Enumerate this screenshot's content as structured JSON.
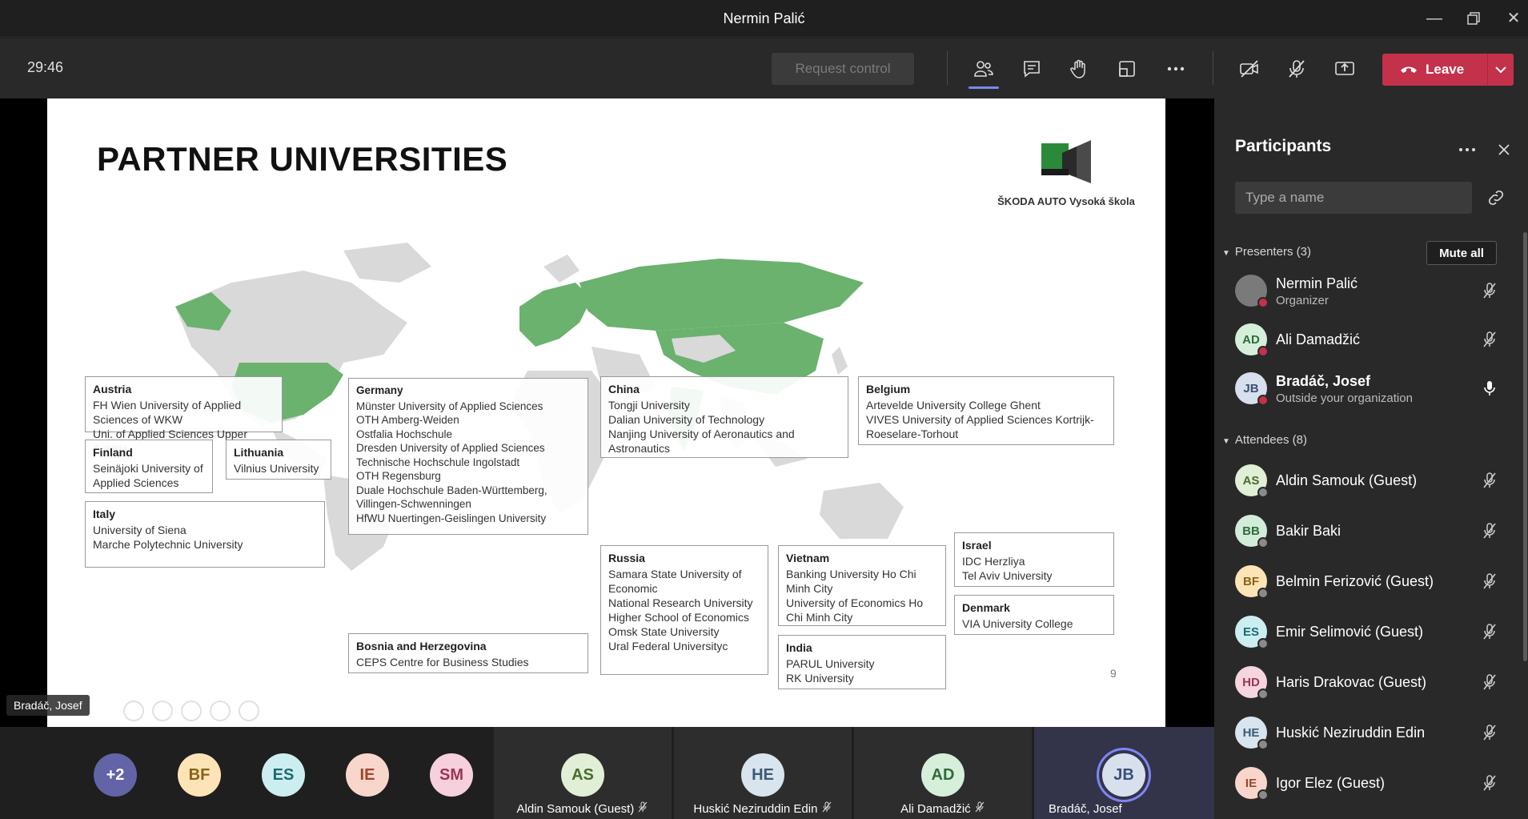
{
  "window": {
    "title": "Nermin Palić"
  },
  "toolbar": {
    "timer": "29:46",
    "request_control": "Request control",
    "leave": "Leave"
  },
  "slide": {
    "title": "PARTNER UNIVERSITIES",
    "logo_text": "ŠKODA AUTO Vysoká škola",
    "page_number": "9",
    "countries": [
      {
        "name": "Austria",
        "unis": [
          "FH Wien University of Applied Sciences of WKW",
          "Uni. of Applied Sciences Upper Austria"
        ]
      },
      {
        "name": "Finland",
        "unis": [
          "Seinäjoki University of Applied Sciences"
        ]
      },
      {
        "name": "Lithuania",
        "unis": [
          "Vilnius University"
        ]
      },
      {
        "name": "Italy",
        "unis": [
          "University of Siena",
          "Marche Polytechnic University"
        ]
      },
      {
        "name": "Germany",
        "unis": [
          "Münster University of Applied Sciences",
          "OTH Amberg-Weiden",
          "Ostfalia Hochschule",
          "Dresden University of Applied Sciences",
          "Technische Hochschule Ingolstadt",
          "OTH Regensburg",
          "Duale Hochschule Baden-Württemberg, Villingen-Schwenningen",
          "HfWU Nuertingen-Geislingen University"
        ]
      },
      {
        "name": "Bosnia and Herzegovina",
        "unis": [
          "CEPS Centre for Business Studies"
        ]
      },
      {
        "name": "China",
        "unis": [
          "Tongji University",
          "Dalian University of Technology",
          "Nanjing University of Aeronautics and Astronautics"
        ]
      },
      {
        "name": "Russia",
        "unis": [
          "Samara State University of Economic",
          "National Research University Higher School of Economics",
          "Omsk State University",
          "Ural Federal Universityc"
        ]
      },
      {
        "name": "Vietnam",
        "unis": [
          "Banking University Ho Chi Minh City",
          "University of Economics Ho Chi Minh City"
        ]
      },
      {
        "name": "India",
        "unis": [
          "PARUL University",
          "RK University"
        ]
      },
      {
        "name": "Belgium",
        "unis": [
          "Artevelde University College Ghent",
          "VIVES University of Applied Sciences Kortrijk-Roeselare-Torhout"
        ]
      },
      {
        "name": "Israel",
        "unis": [
          "IDC Herzliya",
          "Tel Aviv University"
        ]
      },
      {
        "name": "Denmark",
        "unis": [
          "VIA University College"
        ]
      }
    ]
  },
  "presenter_label": "Bradáč, Josef",
  "gallery": {
    "overflow": "+2",
    "small": [
      {
        "initials": "BF",
        "bg": "#fce4b6",
        "fg": "#8a6116"
      },
      {
        "initials": "ES",
        "bg": "#cdeef0",
        "fg": "#1d6a70"
      },
      {
        "initials": "IE",
        "bg": "#f8d6cc",
        "fg": "#a0452b"
      },
      {
        "initials": "SM",
        "bg": "#f6d0dc",
        "fg": "#9b3556"
      }
    ],
    "tiles": [
      {
        "initials": "AS",
        "name": "Aldin Samouk (Guest)",
        "bg": "#e0efd6",
        "fg": "#4a6b2e"
      },
      {
        "initials": "HE",
        "name": "Huskić Neziruddin Edin",
        "bg": "#d8e4ee",
        "fg": "#3c5a74"
      },
      {
        "initials": "AD",
        "name": "Ali Damadžić",
        "bg": "#d6efdb",
        "fg": "#2f6b3c"
      },
      {
        "initials": "JB",
        "name": "Bradáč, Josef",
        "bg": "#d8e0ee",
        "fg": "#3c4f74"
      }
    ]
  },
  "panel": {
    "title": "Participants",
    "search_placeholder": "Type a name",
    "presenters_header": "Presenters (3)",
    "mute_all": "Mute all",
    "attendees_header": "Attendees (8)",
    "presenters": [
      {
        "initials": "",
        "name": "Nermin Palić",
        "sub": "Organizer",
        "bg": "#7a7a7a",
        "fg": "#fff",
        "status": "#c4314b",
        "mic": "muted"
      },
      {
        "initials": "AD",
        "name": "Ali Damadžić",
        "sub": "",
        "bg": "#d6efdb",
        "fg": "#2f6b3c",
        "status": "#c4314b",
        "mic": "muted"
      },
      {
        "initials": "JB",
        "name": "Bradáč, Josef",
        "sub": "Outside your organization",
        "bg": "#d8e0ee",
        "fg": "#3c4f74",
        "status": "#c4314b",
        "mic": "on"
      }
    ],
    "attendees": [
      {
        "initials": "AS",
        "name": "Aldin Samouk (Guest)",
        "bg": "#e0efd6",
        "fg": "#4a6b2e"
      },
      {
        "initials": "BB",
        "name": "Bakir Baki",
        "bg": "#d2ecd9",
        "fg": "#2f6b3c"
      },
      {
        "initials": "BF",
        "name": "Belmin Ferizović (Guest)",
        "bg": "#fce4b6",
        "fg": "#8a6116"
      },
      {
        "initials": "ES",
        "name": "Emir Selimović (Guest)",
        "bg": "#cdeef0",
        "fg": "#1d6a70"
      },
      {
        "initials": "HD",
        "name": "Haris Drakovac (Guest)",
        "bg": "#f6d5de",
        "fg": "#9b3556"
      },
      {
        "initials": "HE",
        "name": "Huskić Neziruddin Edin",
        "bg": "#d8e4ee",
        "fg": "#3c5a74"
      },
      {
        "initials": "IE",
        "name": "Igor Elez (Guest)",
        "bg": "#f8d6cc",
        "fg": "#a0452b"
      }
    ]
  }
}
